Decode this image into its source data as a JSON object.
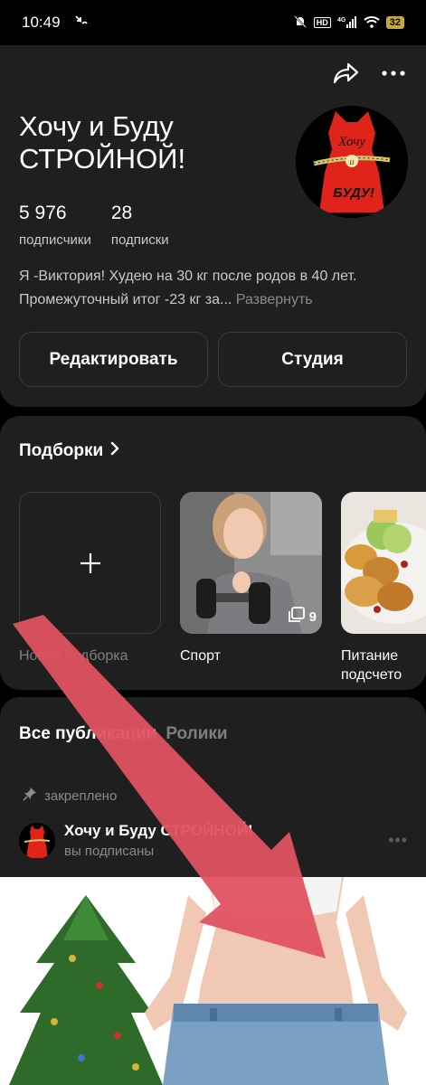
{
  "status": {
    "time": "10:49",
    "network": "4G",
    "hd": "HD",
    "battery": "32"
  },
  "profile": {
    "title": "Хочу и Буду СТРОЙНОЙ!",
    "avatar_text_top": "Хочу",
    "avatar_text_mid": "и",
    "avatar_text_bottom": "БУДУ!",
    "subscribers_count": "5 976",
    "subscribers_label": "подписчики",
    "subscriptions_count": "28",
    "subscriptions_label": "подписки",
    "bio": "Я -Виктория! Худею на 30 кг после родов в 40 лет. Промежуточный итог -23 кг за...",
    "expand_label": "Развернуть",
    "edit_label": "Редактировать",
    "studio_label": "Студия"
  },
  "collections": {
    "header": "Подборки",
    "items": [
      {
        "label": "Новая подборка"
      },
      {
        "label": "Спорт",
        "count": "9"
      },
      {
        "label": "Питание подсчето"
      }
    ]
  },
  "publications": {
    "tab_all": "Все публикации",
    "tab_reels": "Ролики",
    "pinned_label": "закреплено",
    "author": "Хочу и Буду СТРОЙНОЙ!",
    "subscribed": "вы подписаны",
    "more_glyph": "•••"
  },
  "colors": {
    "background": "#000000",
    "card": "#1f1f1f",
    "accent_arrow": "#e05260",
    "avatar_red": "#e0241c"
  }
}
